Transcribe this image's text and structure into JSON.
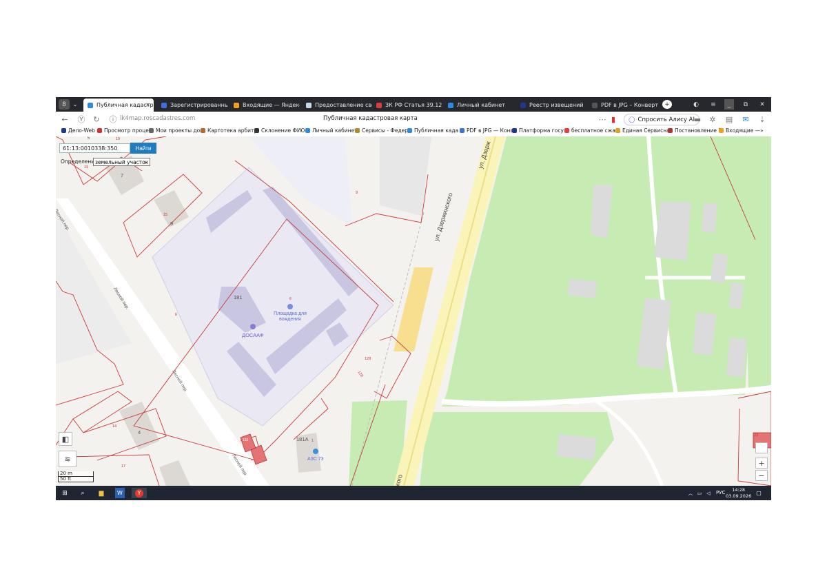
{
  "browser": {
    "tabs": [
      {
        "label": "Публичная кадастро",
        "active": true,
        "color": "#2a8be0"
      },
      {
        "label": "Зарегистрированные с",
        "active": false,
        "color": "#3d6fd9"
      },
      {
        "label": "Входящие — Яндекс По",
        "active": false,
        "color": "#f0a020"
      },
      {
        "label": "Предоставление сведе",
        "active": false,
        "color": "#c8d8e8"
      },
      {
        "label": "ЗК РФ Статья 39.12. Пр",
        "active": false,
        "color": "#d04040"
      },
      {
        "label": "Личный кабинет",
        "active": false,
        "color": "#2a8be0"
      },
      {
        "label": "Реестр извещений",
        "active": false,
        "color": "#1f3a8a"
      },
      {
        "label": "PDF в JPG – Конвертер",
        "active": false,
        "color": "#555"
      }
    ],
    "url": "lk4map.roscadastres.com",
    "page_title": "Публичная кадастровая карта",
    "alice_label": "Спросить Алису AI",
    "bookmarks": [
      {
        "label": "Дело-Web",
        "color": "#1f3a8a"
      },
      {
        "label": "Просмотр проце",
        "color": "#d03030"
      },
      {
        "label": "Мои проекты док",
        "color": "#666"
      },
      {
        "label": "Картотека арбитр",
        "color": "#b06a30"
      },
      {
        "label": "Склонение ФИО",
        "color": "#333"
      },
      {
        "label": "Личный кабинет",
        "color": "#2a8be0"
      },
      {
        "label": "Сервисы - Федер",
        "color": "#b08a30"
      },
      {
        "label": "Публичная када",
        "color": "#2a8be0"
      },
      {
        "label": "PDF в JPG — Конв",
        "color": "#3d6fd9"
      },
      {
        "label": "Платформа госу",
        "color": "#1f3a8a"
      },
      {
        "label": "бесплатное сжат",
        "color": "#e04040"
      },
      {
        "label": "Единая Сервисна",
        "color": "#e0a020"
      },
      {
        "label": "Постановление П",
        "color": "#aa3333"
      },
      {
        "label": "Входящие —",
        "color": "#f0a020"
      }
    ]
  },
  "search": {
    "value": "61:13:0010338:350",
    "button": "Найти",
    "definition_label": "Определение:",
    "definition_value": "земельный участок"
  },
  "map": {
    "street_dzerzhinskogo": "ул. Дзержинского",
    "street_dzerzh_top": "ул. Дзерж",
    "street_dzerzh_bottom": "ского",
    "lane_1": "Лесной пер.",
    "lane_2": "Лесной пер.",
    "lane_3": "Лесной пер.",
    "lane_4": "Лесной пер.",
    "poi_driving": "Площадка для вождения",
    "poi_dosaaf": "ДОСААФ",
    "poi_azs": "АЗС 73",
    "building_181": "181",
    "building_181a": "181А",
    "building_7": "7",
    "building_9": "9",
    "building_4": "4",
    "building_5": "5",
    "parcel_19a": "19",
    "parcel_19b": "19",
    "parcel_15": "15",
    "parcel_6": "6",
    "parcel_6b": "6",
    "parcel_9": "9",
    "parcel_14": "14",
    "parcel_17": "17",
    "parcel_129": "129",
    "parcel_128": "128",
    "parcel_1": "1",
    "parcel_23": "23",
    "parcel_133": "133",
    "scale_m": "20 m",
    "scale_ft": "50 ft",
    "zoom_in": "+",
    "zoom_out": "−"
  },
  "taskbar": {
    "lang": "РУС",
    "time": "14:28",
    "date": "03.09.2026"
  }
}
